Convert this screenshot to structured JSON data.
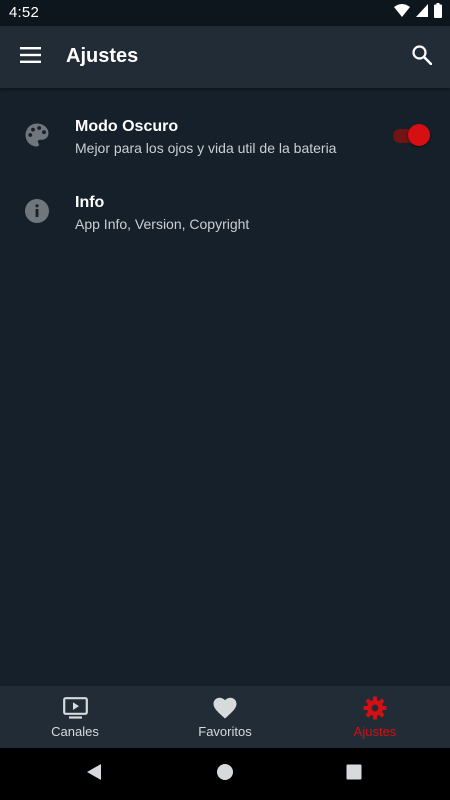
{
  "status_bar": {
    "time": "4:52",
    "icons": [
      "wifi-icon",
      "cell-signal-icon",
      "battery-icon"
    ]
  },
  "app_bar": {
    "title": "Ajustes",
    "menu_icon": "hamburger-menu-icon",
    "search_icon": "search-icon"
  },
  "settings": {
    "items": [
      {
        "icon": "palette-icon",
        "title": "Modo Oscuro",
        "subtitle": "Mejor para los ojos y vida util de la bateria",
        "toggle_on": true
      },
      {
        "icon": "info-icon",
        "title": "Info",
        "subtitle": "App Info, Version, Copyright"
      }
    ]
  },
  "bottom_nav": {
    "items": [
      {
        "label": "Canales",
        "icon": "tv-icon",
        "active": false
      },
      {
        "label": "Favoritos",
        "icon": "heart-icon",
        "active": false
      },
      {
        "label": "Ajustes",
        "icon": "gear-icon",
        "active": true
      }
    ]
  },
  "system_nav": {
    "buttons": [
      "back-icon",
      "home-icon",
      "recents-icon"
    ]
  },
  "colors": {
    "accent": "#d50f12",
    "background": "#16202a",
    "app_bar": "#212c36"
  }
}
